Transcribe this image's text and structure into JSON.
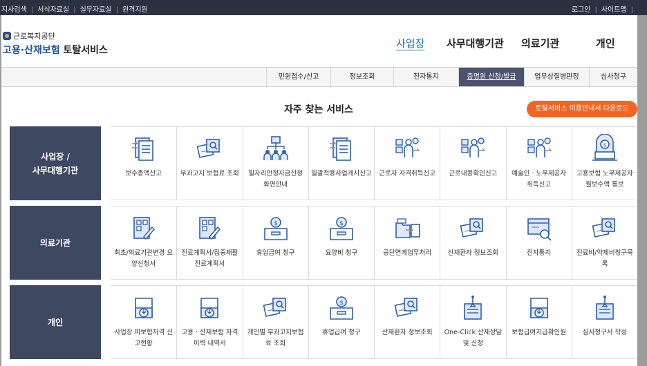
{
  "topbar": {
    "left_links": [
      "지사검색",
      "서식자료실",
      "실무자료실",
      "원격지원"
    ],
    "right_links": [
      "로그인",
      "사이트맵"
    ]
  },
  "logo": {
    "org": "근로복지공단",
    "title_main": "고용·산재보험",
    "title_suffix": "토탈서비스"
  },
  "gnb": [
    "사업장",
    "사무대행기관",
    "의료기관",
    "개인"
  ],
  "subnav": [
    "민원접수/신고",
    "정보조회",
    "전자통지",
    "증명원 신청/발급",
    "업무상질병판정",
    "심사청구"
  ],
  "section_title": "자주 찾는 서비스",
  "guide_button": "토탈서비스 이용안내서 다운로드",
  "colors": {
    "topbar": "#2c3142",
    "category_bg": "#3f4861",
    "accent_orange": "#f26522",
    "link_blue": "#1b6ec2",
    "icon_blue": "#2b5fb3"
  },
  "categories": [
    {
      "label": "사업장 /\n사무대행기관",
      "services": [
        {
          "label": "보수총액신고",
          "icon": "document-list-icon"
        },
        {
          "label": "부과고지 보험료 조회",
          "icon": "card-search-icon"
        },
        {
          "label": "일자리안정자금신청 화면안내",
          "icon": "org-chart-icon"
        },
        {
          "label": "일괄적용사업개시신고",
          "icon": "document-list-icon"
        },
        {
          "label": "근로자 자격취득신고",
          "icon": "person-form-icon"
        },
        {
          "label": "근로내용확인신고",
          "icon": "person-form-icon"
        },
        {
          "label": "예술인 · 노무제공자 취득신고",
          "icon": "person-form-icon"
        },
        {
          "label": "고용보험 노무제공자 월보수액 통보",
          "icon": "money-laptop-icon"
        }
      ]
    },
    {
      "label": "의료기관",
      "services": [
        {
          "label": "최초/의료기관변경 요양신청서",
          "icon": "medical-form-icon"
        },
        {
          "label": "진료계획서/집중재활진료계획서",
          "icon": "medical-form-icon"
        },
        {
          "label": "휴업급여 청구",
          "icon": "money-box-icon"
        },
        {
          "label": "요양비 청구",
          "icon": "money-box-icon"
        },
        {
          "label": "공단연계업무처리",
          "icon": "folder-exchange-icon"
        },
        {
          "label": "산재환자 정보조회",
          "icon": "card-search-icon"
        },
        {
          "label": "전자통지",
          "icon": "monitor-search-icon"
        },
        {
          "label": "진료비/약제비청구목록",
          "icon": "card-search-icon"
        }
      ]
    },
    {
      "label": "개인",
      "services": [
        {
          "label": "사업장 피보험자격 신고현황",
          "icon": "download-box-icon"
        },
        {
          "label": "고용 · 산재보험 자격 이력 내역서",
          "icon": "download-box-icon"
        },
        {
          "label": "개인별 부과고지보험료 조회",
          "icon": "card-search-icon"
        },
        {
          "label": "휴업급여 청구",
          "icon": "money-box-icon"
        },
        {
          "label": "산재환자 정보조회",
          "icon": "card-search-icon"
        },
        {
          "label": "One-Click 산재상담 및 신청",
          "icon": "pen-document-icon"
        },
        {
          "label": "보험급여지급확인원",
          "icon": "download-box-icon"
        },
        {
          "label": "심사청구서 작성",
          "icon": "pen-document-icon"
        }
      ]
    }
  ]
}
